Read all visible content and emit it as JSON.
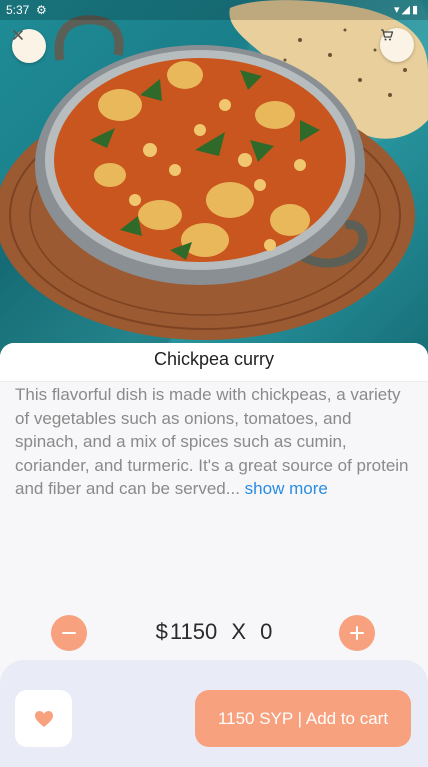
{
  "status_bar": {
    "time": "5:37",
    "settings_icon": "gear-icon",
    "icons": [
      "wifi-icon",
      "signal-icon",
      "battery-icon"
    ]
  },
  "hero": {
    "image": "chickpea-curry-photo",
    "close_icon": "close-icon",
    "cart_icon": "cart-icon"
  },
  "product": {
    "title": "Chickpea curry",
    "description": "This flavorful dish is made with chickpeas, a variety of vegetables such as onions, tomatoes, and spinach, and a mix of spices such as cumin, coriander, and turmeric. It's a great source of protein and fiber and can be served",
    "ellipsis": "... ",
    "show_more": "show more"
  },
  "quantity": {
    "minus_label": "−",
    "plus_label": "+",
    "currency": "$",
    "price": "1150",
    "times": "X",
    "count": "0"
  },
  "bottom_bar": {
    "favorite_icon": "heart-icon",
    "add_to_cart_label": "1150 SYP | Add to cart"
  },
  "colors": {
    "accent": "#f7a17f",
    "link": "#2b8ce0",
    "bottom_bar_bg": "#e9ecf6"
  }
}
